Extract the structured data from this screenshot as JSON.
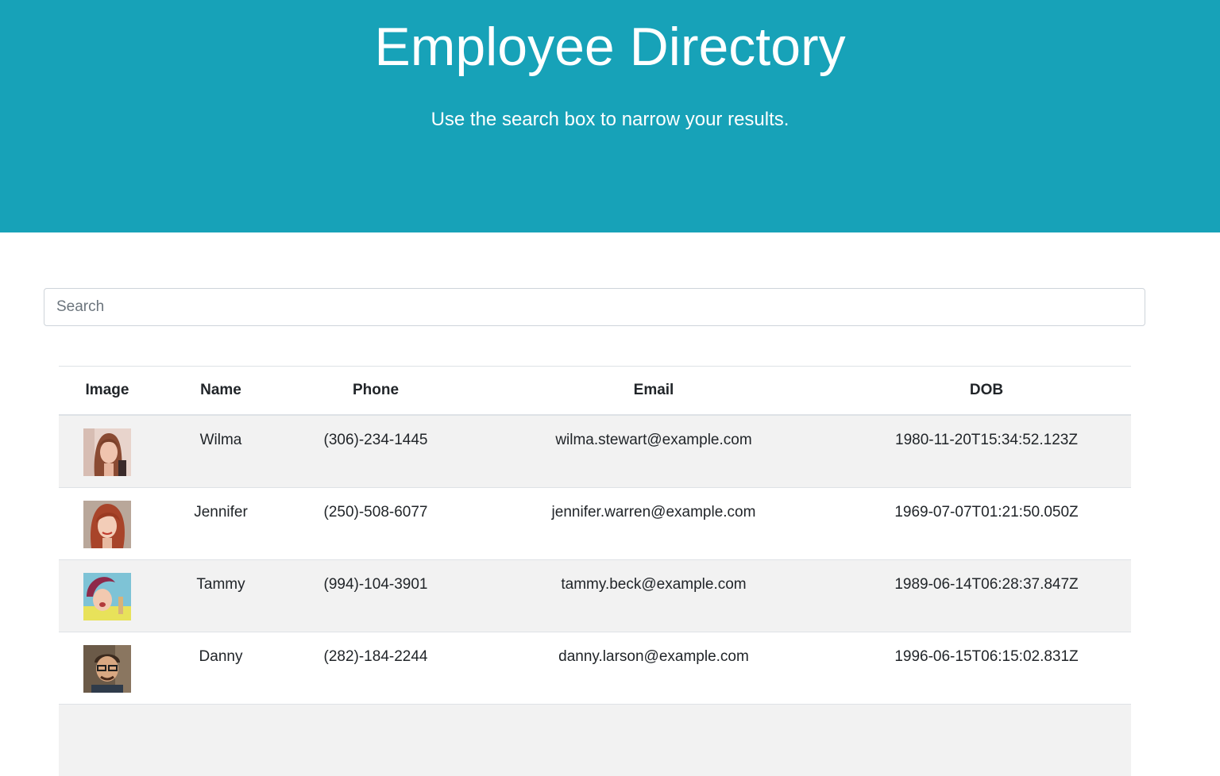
{
  "header": {
    "title": "Employee Directory",
    "subtitle": "Use the search box to narrow your results."
  },
  "search": {
    "placeholder": "Search",
    "value": ""
  },
  "table": {
    "columns": [
      "Image",
      "Name",
      "Phone",
      "Email",
      "DOB"
    ],
    "rows": [
      {
        "avatar": "avatar-wilma",
        "name": "Wilma",
        "phone": "(306)-234-1445",
        "email": "wilma.stewart@example.com",
        "dob": "1980-11-20T15:34:52.123Z"
      },
      {
        "avatar": "avatar-jennifer",
        "name": "Jennifer",
        "phone": "(250)-508-6077",
        "email": "jennifer.warren@example.com",
        "dob": "1969-07-07T01:21:50.050Z"
      },
      {
        "avatar": "avatar-tammy",
        "name": "Tammy",
        "phone": "(994)-104-3901",
        "email": "tammy.beck@example.com",
        "dob": "1989-06-14T06:28:37.847Z"
      },
      {
        "avatar": "avatar-danny",
        "name": "Danny",
        "phone": "(282)-184-2244",
        "email": "danny.larson@example.com",
        "dob": "1996-06-15T06:15:02.831Z"
      }
    ]
  },
  "colors": {
    "hero_bg": "#17a2b8",
    "stripe": "#f2f2f2",
    "border": "#dee2e6"
  }
}
